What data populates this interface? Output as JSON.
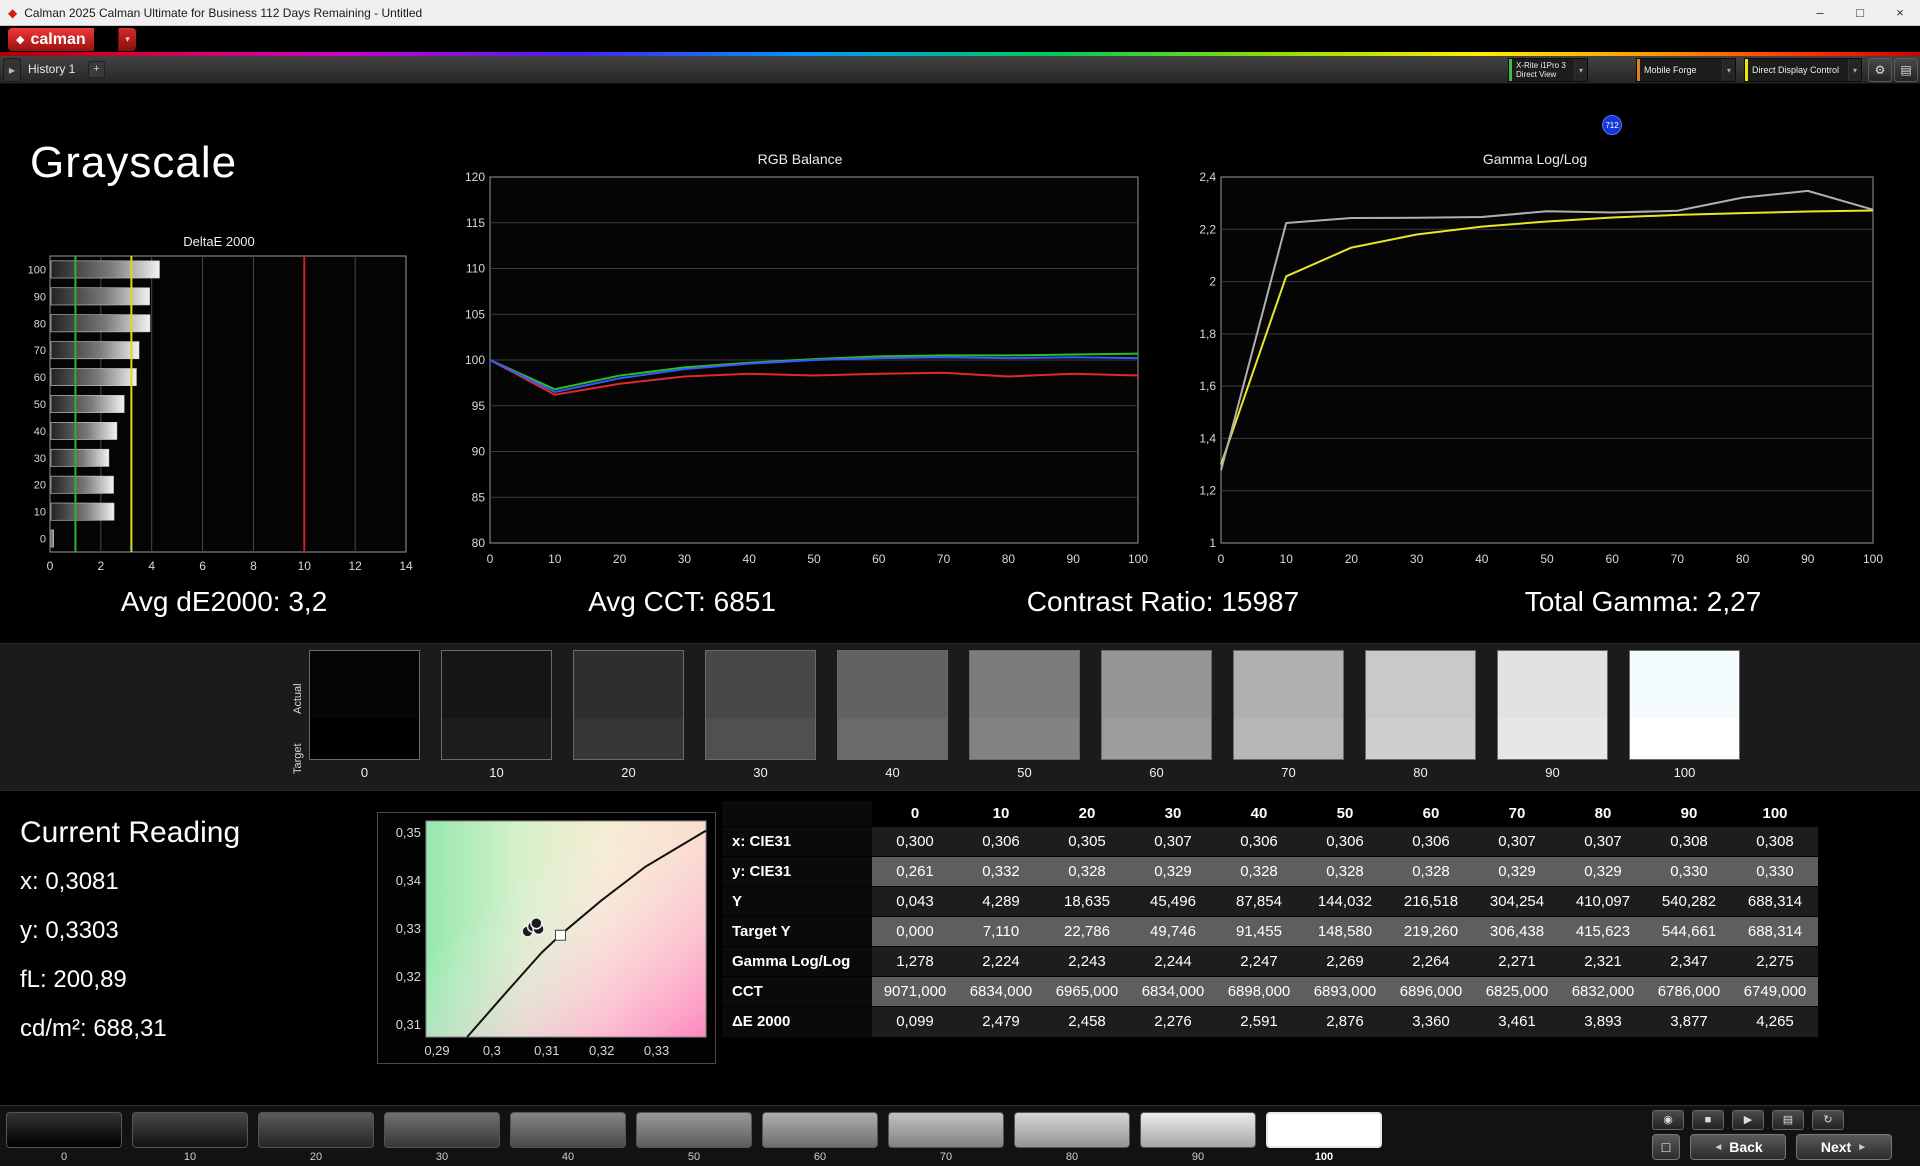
{
  "window": {
    "title": "Calman 2025 Calman Ultimate for Business 112 Days Remaining  - Untitled"
  },
  "brand": {
    "logo_text": "calman"
  },
  "icons": {
    "app_diamond": "◆",
    "minimize": "–",
    "maximize": "□",
    "close": "×",
    "logo_diamond": "◆",
    "logo_dropdown": "▾",
    "history_expand": "▶",
    "add_tab": "+",
    "dropdown_chevron": "▾",
    "gear": "⚙",
    "layout": "▤",
    "meter": "◉",
    "stop": "■",
    "play": "▶",
    "pattern_grid": "▤",
    "refresh": "↻",
    "pattern_window": "□",
    "back_arrow": "◄",
    "next_arrow": "►"
  },
  "toolbar": {
    "history_tab": "History 1",
    "meter_line1": "X-Rite i1Pro 3",
    "meter_line2": "Direct View",
    "badge": "712",
    "source": "Mobile Forge",
    "display_control": "Direct Display Control",
    "accent_green": "#3fbf3f",
    "accent_orange": "#e08020",
    "accent_yellow": "#e8e800"
  },
  "page": {
    "title": "Grayscale"
  },
  "summary": {
    "avg_de2000": "Avg dE2000: 3,2",
    "avg_cct": "Avg CCT: 6851",
    "contrast": "Contrast Ratio: 15987",
    "total_gamma": "Total Gamma: 2,27"
  },
  "chart_data": [
    {
      "type": "bar",
      "title": "DeltaE 2000",
      "orientation": "horizontal",
      "categories": [
        "100",
        "90",
        "80",
        "70",
        "60",
        "50",
        "40",
        "30",
        "20",
        "10",
        "0"
      ],
      "values": [
        4.265,
        3.877,
        3.893,
        3.461,
        3.36,
        2.876,
        2.591,
        2.276,
        2.458,
        2.479,
        0.099
      ],
      "xlim": [
        0,
        14
      ],
      "x_ticks": [
        "0",
        "2",
        "4",
        "6",
        "8",
        "10",
        "12",
        "14"
      ],
      "reference_lines": [
        {
          "name": "max-tolerance",
          "value": 10,
          "color": "#cc2222"
        },
        {
          "name": "target",
          "value": 1,
          "color": "#2ab62a"
        },
        {
          "name": "average",
          "value": 3.2,
          "color": "#d9d922"
        }
      ]
    },
    {
      "type": "line",
      "title": "RGB Balance",
      "x": [
        0,
        10,
        20,
        30,
        40,
        50,
        60,
        70,
        80,
        90,
        100
      ],
      "x_ticks": [
        "0",
        "10",
        "20",
        "30",
        "40",
        "50",
        "60",
        "70",
        "80",
        "90",
        "100"
      ],
      "ylim": [
        80,
        120
      ],
      "y_ticks": [
        "120",
        "115",
        "110",
        "105",
        "100",
        "95",
        "90",
        "85",
        "80"
      ],
      "y_tick_vals": [
        120,
        115,
        110,
        105,
        100,
        95,
        90,
        85,
        80
      ],
      "series": [
        {
          "name": "Red",
          "color": "#e02828",
          "values": [
            100,
            96.2,
            97.4,
            98.2,
            98.5,
            98.3,
            98.5,
            98.6,
            98.2,
            98.5,
            98.3
          ]
        },
        {
          "name": "Green",
          "color": "#28c028",
          "values": [
            100,
            96.8,
            98.3,
            99.2,
            99.7,
            100.1,
            100.4,
            100.5,
            100.5,
            100.6,
            100.7
          ]
        },
        {
          "name": "Blue",
          "color": "#3858ff",
          "values": [
            100,
            96.5,
            98.0,
            99.0,
            99.6,
            100.0,
            100.2,
            100.3,
            100.2,
            100.3,
            100.2
          ]
        }
      ]
    },
    {
      "type": "line",
      "title": "Gamma Log/Log",
      "x": [
        0,
        10,
        20,
        30,
        40,
        50,
        60,
        70,
        80,
        90,
        100
      ],
      "x_ticks": [
        "0",
        "10",
        "20",
        "30",
        "40",
        "50",
        "60",
        "70",
        "80",
        "90",
        "100"
      ],
      "ylim": [
        1,
        2.4
      ],
      "y_ticks": [
        "2,4",
        "2,2",
        "2",
        "1,8",
        "1,6",
        "1,4",
        "1,2",
        "1"
      ],
      "y_tick_vals": [
        2.4,
        2.2,
        2,
        1.8,
        1.6,
        1.4,
        1.2,
        1
      ],
      "series": [
        {
          "name": "Target Gamma",
          "color": "#e6e62a",
          "values": [
            1.3,
            2.02,
            2.13,
            2.18,
            2.21,
            2.23,
            2.245,
            2.255,
            2.262,
            2.268,
            2.272
          ]
        },
        {
          "name": "Measured Gamma",
          "color": "#b0b0b0",
          "values": [
            1.278,
            2.224,
            2.243,
            2.244,
            2.247,
            2.269,
            2.264,
            2.271,
            2.321,
            2.347,
            2.275
          ]
        }
      ]
    },
    {
      "type": "scatter",
      "xlim": [
        0.288,
        0.339
      ],
      "ylim": [
        0.3075,
        0.3525
      ],
      "x_ticks": [
        "0,29",
        "0,3",
        "0,31",
        "0,32",
        "0,33"
      ],
      "x_tick_vals": [
        0.29,
        0.3,
        0.31,
        0.32,
        0.33
      ],
      "y_ticks": [
        "0,35",
        "0,34",
        "0,33",
        "0,32",
        "0,31"
      ],
      "y_tick_vals": [
        0.35,
        0.34,
        0.33,
        0.32,
        0.31
      ],
      "locus": [
        [
          0.2955,
          0.3075
        ],
        [
          0.302,
          0.316
        ],
        [
          0.309,
          0.325
        ],
        [
          0.3127,
          0.329
        ],
        [
          0.32,
          0.336
        ],
        [
          0.328,
          0.343
        ],
        [
          0.339,
          0.3505
        ]
      ],
      "target_point": [
        0.3125,
        0.3287
      ],
      "measured_points": [
        [
          0.3065,
          0.3295
        ],
        [
          0.3075,
          0.3305
        ],
        [
          0.3085,
          0.33
        ],
        [
          0.3081,
          0.3312
        ]
      ]
    }
  ],
  "swatches": {
    "actual_label": "Actual",
    "target_label": "Target",
    "items": [
      {
        "label": "0",
        "actual": "#050505",
        "target": "#000000"
      },
      {
        "label": "10",
        "actual": "#151515",
        "target": "#1c1c1c"
      },
      {
        "label": "20",
        "actual": "#2e2e2e",
        "target": "#363636"
      },
      {
        "label": "30",
        "actual": "#484848",
        "target": "#505050"
      },
      {
        "label": "40",
        "actual": "#626262",
        "target": "#6a6a6a"
      },
      {
        "label": "50",
        "actual": "#7c7c7c",
        "target": "#838383"
      },
      {
        "label": "60",
        "actual": "#969696",
        "target": "#9d9d9d"
      },
      {
        "label": "70",
        "actual": "#b0b0b0",
        "target": "#b6b6b6"
      },
      {
        "label": "80",
        "actual": "#c9c9c9",
        "target": "#cfcfcf"
      },
      {
        "label": "90",
        "actual": "#e2e2e2",
        "target": "#e7e7e7"
      },
      {
        "label": "100",
        "actual": "#f4fbfd",
        "target": "#ffffff"
      }
    ]
  },
  "current_reading": {
    "title": "Current Reading",
    "lines": [
      "x: 0,3081",
      "y: 0,3303",
      "fL: 200,89",
      "cd/m²: 688,31"
    ]
  },
  "table": {
    "columns": [
      "0",
      "10",
      "20",
      "30",
      "40",
      "50",
      "60",
      "70",
      "80",
      "90",
      "100"
    ],
    "rows": [
      {
        "label": "x: CIE31",
        "values": [
          "0,300",
          "0,306",
          "0,305",
          "0,307",
          "0,306",
          "0,306",
          "0,306",
          "0,307",
          "0,307",
          "0,308",
          "0,308"
        ]
      },
      {
        "label": "y: CIE31",
        "values": [
          "0,261",
          "0,332",
          "0,328",
          "0,329",
          "0,328",
          "0,328",
          "0,328",
          "0,329",
          "0,329",
          "0,330",
          "0,330"
        ]
      },
      {
        "label": "Y",
        "values": [
          "0,043",
          "4,289",
          "18,635",
          "45,496",
          "87,854",
          "144,032",
          "216,518",
          "304,254",
          "410,097",
          "540,282",
          "688,314"
        ]
      },
      {
        "label": "Target Y",
        "values": [
          "0,000",
          "7,110",
          "22,786",
          "49,746",
          "91,455",
          "148,580",
          "219,260",
          "306,438",
          "415,623",
          "544,661",
          "688,314"
        ]
      },
      {
        "label": "Gamma Log/Log",
        "values": [
          "1,278",
          "2,224",
          "2,243",
          "2,244",
          "2,247",
          "2,269",
          "2,264",
          "2,271",
          "2,321",
          "2,347",
          "2,275"
        ]
      },
      {
        "label": "CCT",
        "values": [
          "9071,000",
          "6834,000",
          "6965,000",
          "6834,000",
          "6898,000",
          "6893,000",
          "6896,000",
          "6825,000",
          "6832,000",
          "6786,000",
          "6749,000"
        ]
      },
      {
        "label": "ΔE 2000",
        "values": [
          "0,099",
          "2,479",
          "2,458",
          "2,276",
          "2,591",
          "2,876",
          "3,360",
          "3,461",
          "3,893",
          "3,877",
          "4,265"
        ]
      }
    ]
  },
  "bottom_bar": {
    "patterns": [
      {
        "label": "0",
        "color": "#000000"
      },
      {
        "label": "10",
        "color": "#1a1a1a"
      },
      {
        "label": "20",
        "color": "#333333"
      },
      {
        "label": "30",
        "color": "#4d4d4d"
      },
      {
        "label": "40",
        "color": "#666666"
      },
      {
        "label": "50",
        "color": "#808080"
      },
      {
        "label": "60",
        "color": "#999999"
      },
      {
        "label": "70",
        "color": "#b3b3b3"
      },
      {
        "label": "80",
        "color": "#cccccc"
      },
      {
        "label": "90",
        "color": "#e6e6e6"
      },
      {
        "label": "100",
        "color": "#ffffff",
        "selected": true
      }
    ],
    "back_label": "Back",
    "next_label": "Next"
  }
}
